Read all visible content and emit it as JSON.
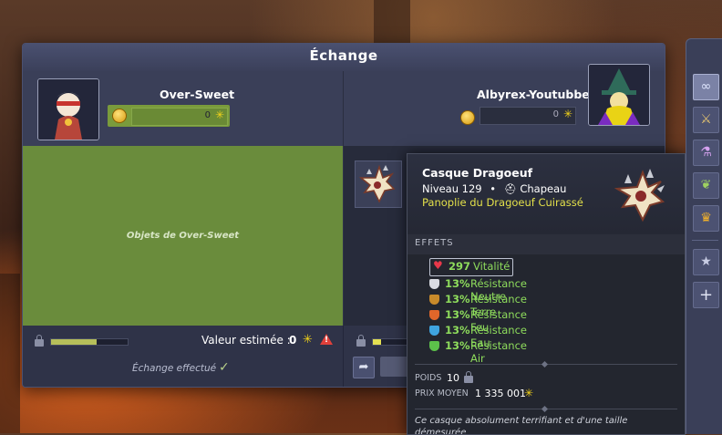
{
  "window": {
    "title": "Échange"
  },
  "left_player": {
    "name": "Over-Sweet",
    "kamas": "0",
    "zone_label": "Objets de Over-Sweet",
    "estimate_label": "Valeur estimée :",
    "estimate_value": "0",
    "status": "Échange effectué",
    "pods_fill": 0.6
  },
  "right_player": {
    "name": "Albyrex-Youtubbe",
    "kamas": "0",
    "pods_fill": 0.15
  },
  "tooltip": {
    "name": "Casque Dragoeuf",
    "level_label": "Niveau",
    "level": "129",
    "bullet": "•",
    "type": "Chapeau",
    "set": "Panoplie du Dragoeuf Cuirassé",
    "effects_title": "EFFETS",
    "effects": [
      {
        "value": "297",
        "label": "Vitalité",
        "icon": "heart-icon",
        "color": "#e8384a"
      },
      {
        "value": "13%",
        "label": "Résistance Neutre",
        "icon": "shield-neutral-icon",
        "color": "#d9dbe2"
      },
      {
        "value": "13%",
        "label": "Résistance Terre",
        "icon": "shield-earth-icon",
        "color": "#c88a2a"
      },
      {
        "value": "13%",
        "label": "Résistance Feu",
        "icon": "shield-fire-icon",
        "color": "#e0662a"
      },
      {
        "value": "13%",
        "label": "Résistance Eau",
        "icon": "shield-water-icon",
        "color": "#3fa4e0"
      },
      {
        "value": "13%",
        "label": "Résistance Air",
        "icon": "shield-air-icon",
        "color": "#5cc04a"
      }
    ],
    "weight_label": "POIDS",
    "weight": "10",
    "price_label": "PRIX MOYEN",
    "price": "1 335 001",
    "description": "Ce casque absolument terrifiant et d'une taille démesurée"
  },
  "sidebar": {
    "buttons": [
      {
        "icon": "infinity-icon",
        "glyph": "∞"
      },
      {
        "icon": "sword-icon",
        "glyph": "⚔"
      },
      {
        "icon": "potion-icon",
        "glyph": "⚗"
      },
      {
        "icon": "leaf-icon",
        "glyph": "❦"
      },
      {
        "icon": "crown-icon",
        "glyph": "♛"
      },
      {
        "icon": "star-icon",
        "glyph": "★"
      },
      {
        "icon": "plus-icon",
        "glyph": "+"
      }
    ]
  },
  "colors": {
    "kama_star": "#f2d21a",
    "effect_green": "#8edc5c",
    "set_yellow": "#e3e04a",
    "left_zone": "#6a8c3c"
  }
}
